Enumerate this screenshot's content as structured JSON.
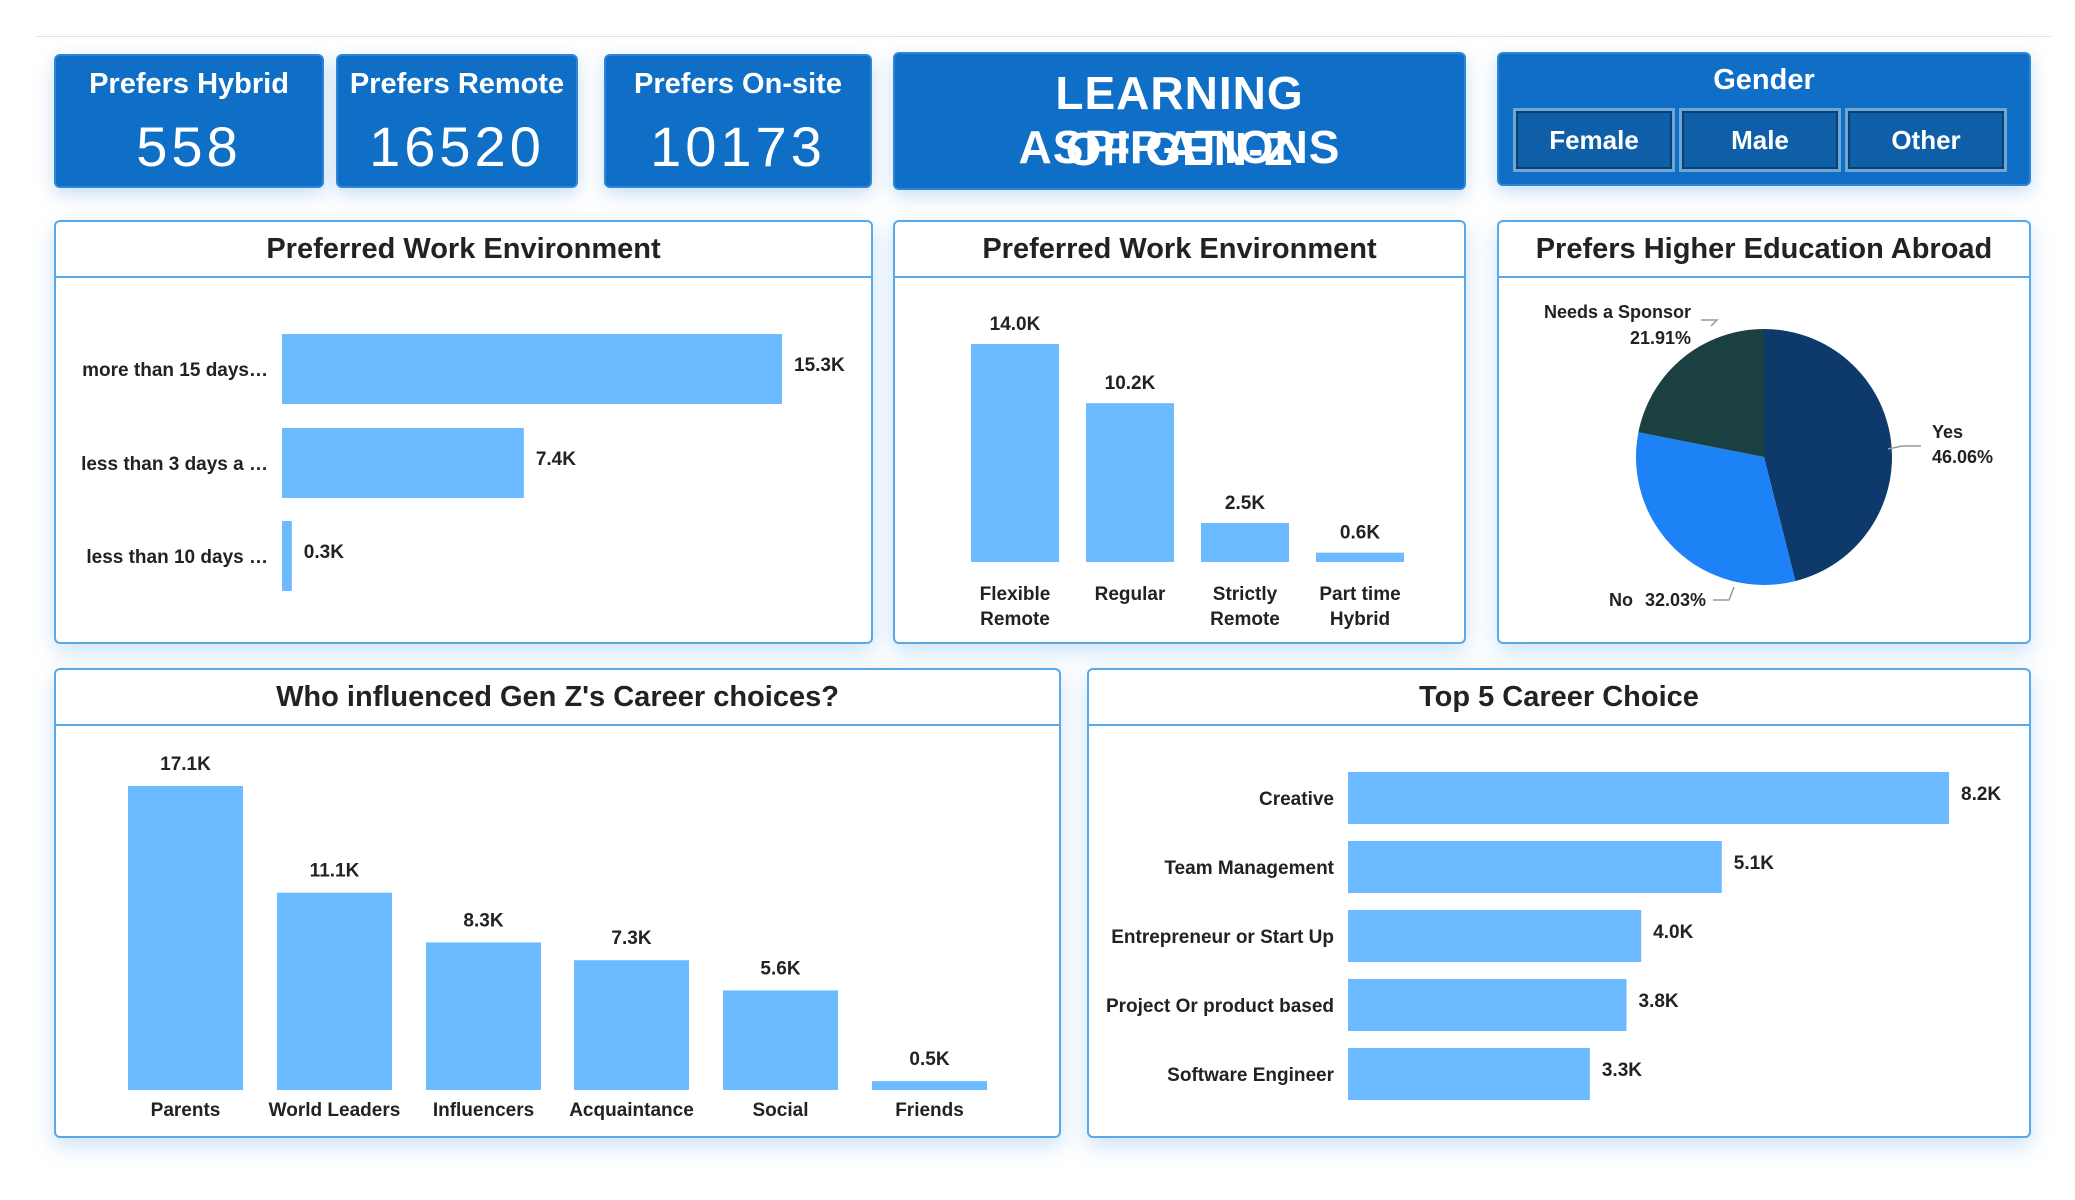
{
  "kpis": [
    {
      "label": "Prefers Hybrid",
      "value": "558"
    },
    {
      "label": "Prefers Remote",
      "value": "16520"
    },
    {
      "label": "Prefers On-site",
      "value": "10173"
    }
  ],
  "title": {
    "line1": "LEARNING ASPIRATIONS",
    "line2": "OF GEN-Z"
  },
  "gender": {
    "label": "Gender",
    "options": [
      "Female",
      "Male",
      "Other"
    ]
  },
  "colors": {
    "accent": "#0f6fc6",
    "bar": "#6cbaff",
    "pie_yes": "#0d3a6b",
    "pie_no": "#1e82f7",
    "pie_sponsor": "#1b4042"
  },
  "chart_data": [
    {
      "type": "bar",
      "orientation": "horizontal",
      "title": "Preferred Work Environment",
      "categories": [
        "more than 15 days…",
        "less than 3 days a …",
        "less than 10 days …"
      ],
      "values": [
        15.3,
        7.4,
        0.3
      ],
      "labels": [
        "15.3K",
        "7.4K",
        "0.3K"
      ]
    },
    {
      "type": "bar",
      "title": "Preferred Work Environment",
      "categories": [
        [
          "Flexible",
          "Remote"
        ],
        [
          "Regular"
        ],
        [
          "Strictly",
          "Remote"
        ],
        [
          "Part time",
          "Hybrid"
        ]
      ],
      "values": [
        14.0,
        10.2,
        2.5,
        0.6
      ],
      "labels": [
        "14.0K",
        "10.2K",
        "2.5K",
        "0.6K"
      ]
    },
    {
      "type": "pie",
      "title": "Prefers Higher Education Abroad",
      "slices": [
        {
          "name": "Yes",
          "value": 46.06,
          "label": "46.06%"
        },
        {
          "name": "No",
          "value": 32.03,
          "label": "32.03%"
        },
        {
          "name": "Needs a Sponsor",
          "value": 21.91,
          "label": "21.91%"
        }
      ]
    },
    {
      "type": "bar",
      "title": "Who influenced Gen Z's Career choices?",
      "categories": [
        "Parents",
        "World Leaders",
        "Influencers",
        "Acquaintance",
        "Social",
        "Friends"
      ],
      "values": [
        17.1,
        11.1,
        8.3,
        7.3,
        5.6,
        0.5
      ],
      "labels": [
        "17.1K",
        "11.1K",
        "8.3K",
        "7.3K",
        "5.6K",
        "0.5K"
      ]
    },
    {
      "type": "bar",
      "orientation": "horizontal",
      "title": "Top 5 Career Choice",
      "categories": [
        "Creative",
        "Team Management",
        "Entrepreneur or Start Up",
        "Project Or product based",
        "Software Engineer"
      ],
      "values": [
        8.2,
        5.1,
        4.0,
        3.8,
        3.3
      ],
      "labels": [
        "8.2K",
        "5.1K",
        "4.0K",
        "3.8K",
        "3.3K"
      ]
    }
  ]
}
